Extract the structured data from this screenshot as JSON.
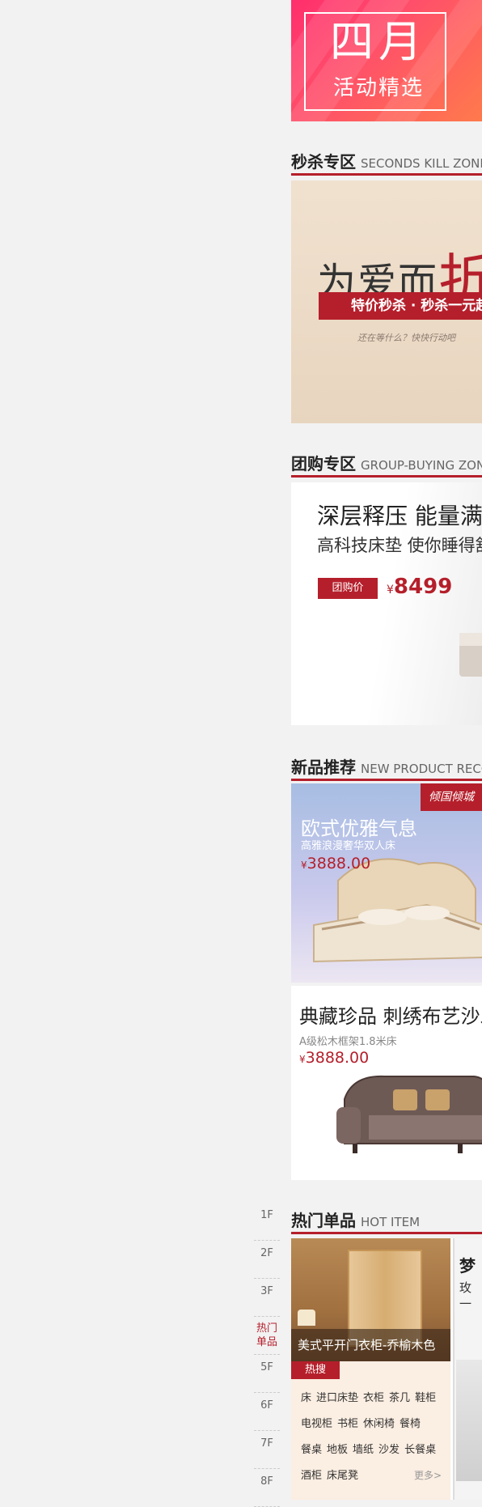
{
  "promo": {
    "line1": "四月",
    "line2": "活动精选"
  },
  "seckill": {
    "title_cn": "秒杀专区",
    "title_en": "SECONDS KILL ZONE",
    "headline": "为爱而",
    "headline_accent": "折",
    "bar_text": "特价秒杀 · 秒杀一元起",
    "hint": "还在等什么？快快行动吧"
  },
  "group": {
    "title_cn": "团购专区",
    "title_en": "GROUP-BUYING ZONE",
    "headline": "深层释压 能量满满",
    "subline": "高科技床垫 使你睡得舒适",
    "tag": "团购价",
    "currency": "¥",
    "price": "8499"
  },
  "newp": {
    "title_cn": "新品推荐",
    "title_en": "NEW PRODUCT RECOMMEND",
    "bed": {
      "ribbon": "倾国倾城",
      "headline": "欧式优雅气息",
      "subline": "高雅浪漫奢华双人床",
      "currency": "¥",
      "price": "3888.00"
    },
    "sofa": {
      "headline": "典藏珍品 刺绣布艺沙发",
      "subline": "A级松木框架1.8米床",
      "currency": "¥",
      "price": "3888.00"
    }
  },
  "floors": [
    "1F",
    "2F",
    "3F",
    "热门单品",
    "5F",
    "6F",
    "7F",
    "8F"
  ],
  "hot": {
    "title_cn": "热门单品",
    "title_en": "HOT ITEM",
    "caption": "美式平开门衣柜-乔榆木色",
    "tag": "热搜",
    "keywords": [
      "床",
      "进口床垫",
      "衣柜",
      "茶几",
      "鞋柜",
      "电视柜",
      "书柜",
      "休闲椅",
      "餐椅",
      "餐桌",
      "地板",
      "墙纸",
      "沙发",
      "长餐桌",
      "酒柜",
      "床尾凳"
    ],
    "more": "更多>",
    "right_title": "梦",
    "right_sub1": "玫",
    "right_sub2": "一"
  },
  "colors": {
    "accent": "#b51f2b",
    "background": "#f2f2f2"
  }
}
